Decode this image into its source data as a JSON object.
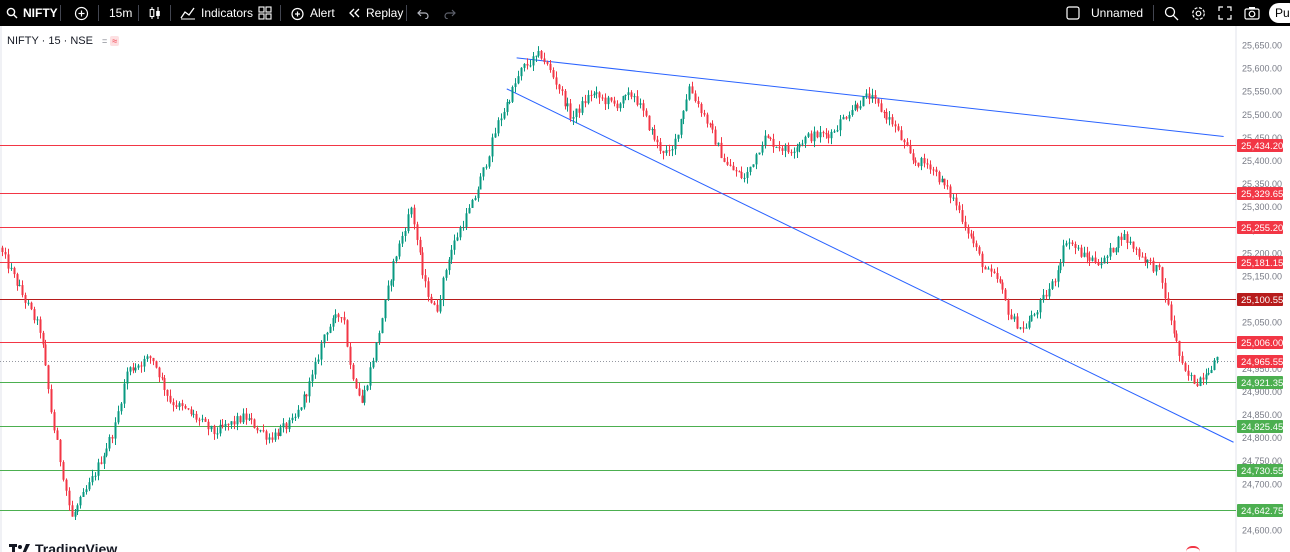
{
  "toolbar": {
    "symbol": "NIFTY",
    "interval": "15m",
    "indicators_label": "Indicators",
    "alert_label": "Alert",
    "replay_label": "Replay",
    "layout_name": "Unnamed",
    "publish_label": "Pu"
  },
  "legend": {
    "title": "NIFTY · 15 · NSE",
    "badge_a": "=",
    "badge_b": "≈"
  },
  "watermark": "TradingView",
  "colors": {
    "up": "#089981",
    "down": "#f23645",
    "trendline": "#2962ff",
    "resistance": "#f23645",
    "support": "#4caf50",
    "dark_level": "#b71c1c"
  },
  "chart_data": {
    "type": "candlestick",
    "price_axis": {
      "min": 24600,
      "max": 25650,
      "ticks": [
        "25,650.00",
        "25,600.00",
        "25,550.00",
        "25,500.00",
        "25,450.00",
        "25,400.00",
        "25,350.00",
        "25,300.00",
        "25,250.00",
        "25,200.00",
        "25,150.00",
        "25,100.00",
        "25,050.00",
        "25,000.00",
        "24,950.00",
        "24,900.00",
        "24,850.00",
        "24,800.00",
        "24,750.00",
        "24,700.00",
        "24,650.00",
        "24,600.00"
      ]
    },
    "levels": [
      {
        "price": 25434.2,
        "label": "25,434.20",
        "kind": "resistance"
      },
      {
        "price": 25329.65,
        "label": "25,329.65",
        "kind": "resistance"
      },
      {
        "price": 25255.2,
        "label": "25,255.20",
        "kind": "resistance"
      },
      {
        "price": 25181.15,
        "label": "25,181.15",
        "kind": "resistance"
      },
      {
        "price": 25100.55,
        "label": "25,100.55",
        "kind": "dark"
      },
      {
        "price": 25006.0,
        "label": "25,006.00",
        "kind": "resistance"
      },
      {
        "price": 24921.35,
        "label": "24,921.35",
        "kind": "support"
      },
      {
        "price": 24825.45,
        "label": "24,825.45",
        "kind": "support"
      },
      {
        "price": 24730.55,
        "label": "24,730.55",
        "kind": "support"
      },
      {
        "price": 24642.75,
        "label": "24,642.75",
        "kind": "support"
      }
    ],
    "last_price": {
      "price": 24965.55,
      "label": "24,965.55"
    },
    "trendlines": [
      {
        "from": [
          0.418,
          25622
        ],
        "to": [
          0.99,
          25452
        ]
      },
      {
        "from": [
          0.41,
          25555
        ],
        "to": [
          0.998,
          24790
        ]
      }
    ],
    "path": [
      [
        0.0,
        25220
      ],
      [
        0.035,
        25030
      ],
      [
        0.045,
        24835
      ],
      [
        0.06,
        24625
      ],
      [
        0.075,
        24700
      ],
      [
        0.095,
        24820
      ],
      [
        0.105,
        24945
      ],
      [
        0.125,
        24975
      ],
      [
        0.14,
        24880
      ],
      [
        0.16,
        24845
      ],
      [
        0.175,
        24810
      ],
      [
        0.2,
        24845
      ],
      [
        0.22,
        24800
      ],
      [
        0.24,
        24835
      ],
      [
        0.255,
        24930
      ],
      [
        0.265,
        25030
      ],
      [
        0.28,
        25075
      ],
      [
        0.285,
        24960
      ],
      [
        0.295,
        24875
      ],
      [
        0.305,
        24980
      ],
      [
        0.32,
        25170
      ],
      [
        0.335,
        25300
      ],
      [
        0.345,
        25140
      ],
      [
        0.355,
        25070
      ],
      [
        0.365,
        25190
      ],
      [
        0.375,
        25255
      ],
      [
        0.385,
        25310
      ],
      [
        0.395,
        25390
      ],
      [
        0.405,
        25480
      ],
      [
        0.415,
        25540
      ],
      [
        0.425,
        25600
      ],
      [
        0.44,
        25630
      ],
      [
        0.455,
        25555
      ],
      [
        0.465,
        25490
      ],
      [
        0.48,
        25545
      ],
      [
        0.5,
        25520
      ],
      [
        0.515,
        25545
      ],
      [
        0.535,
        25430
      ],
      [
        0.545,
        25410
      ],
      [
        0.56,
        25560
      ],
      [
        0.575,
        25480
      ],
      [
        0.59,
        25390
      ],
      [
        0.605,
        25360
      ],
      [
        0.62,
        25450
      ],
      [
        0.64,
        25420
      ],
      [
        0.655,
        25450
      ],
      [
        0.675,
        25460
      ],
      [
        0.69,
        25510
      ],
      [
        0.705,
        25540
      ],
      [
        0.725,
        25480
      ],
      [
        0.74,
        25400
      ],
      [
        0.755,
        25390
      ],
      [
        0.765,
        25350
      ],
      [
        0.775,
        25310
      ],
      [
        0.785,
        25250
      ],
      [
        0.8,
        25160
      ],
      [
        0.81,
        25140
      ],
      [
        0.82,
        25060
      ],
      [
        0.83,
        25035
      ],
      [
        0.84,
        25070
      ],
      [
        0.855,
        25140
      ],
      [
        0.865,
        25230
      ],
      [
        0.88,
        25190
      ],
      [
        0.895,
        25180
      ],
      [
        0.91,
        25240
      ],
      [
        0.925,
        25195
      ],
      [
        0.94,
        25160
      ],
      [
        0.95,
        25050
      ],
      [
        0.96,
        24940
      ],
      [
        0.97,
        24920
      ],
      [
        0.985,
        24965
      ]
    ]
  }
}
